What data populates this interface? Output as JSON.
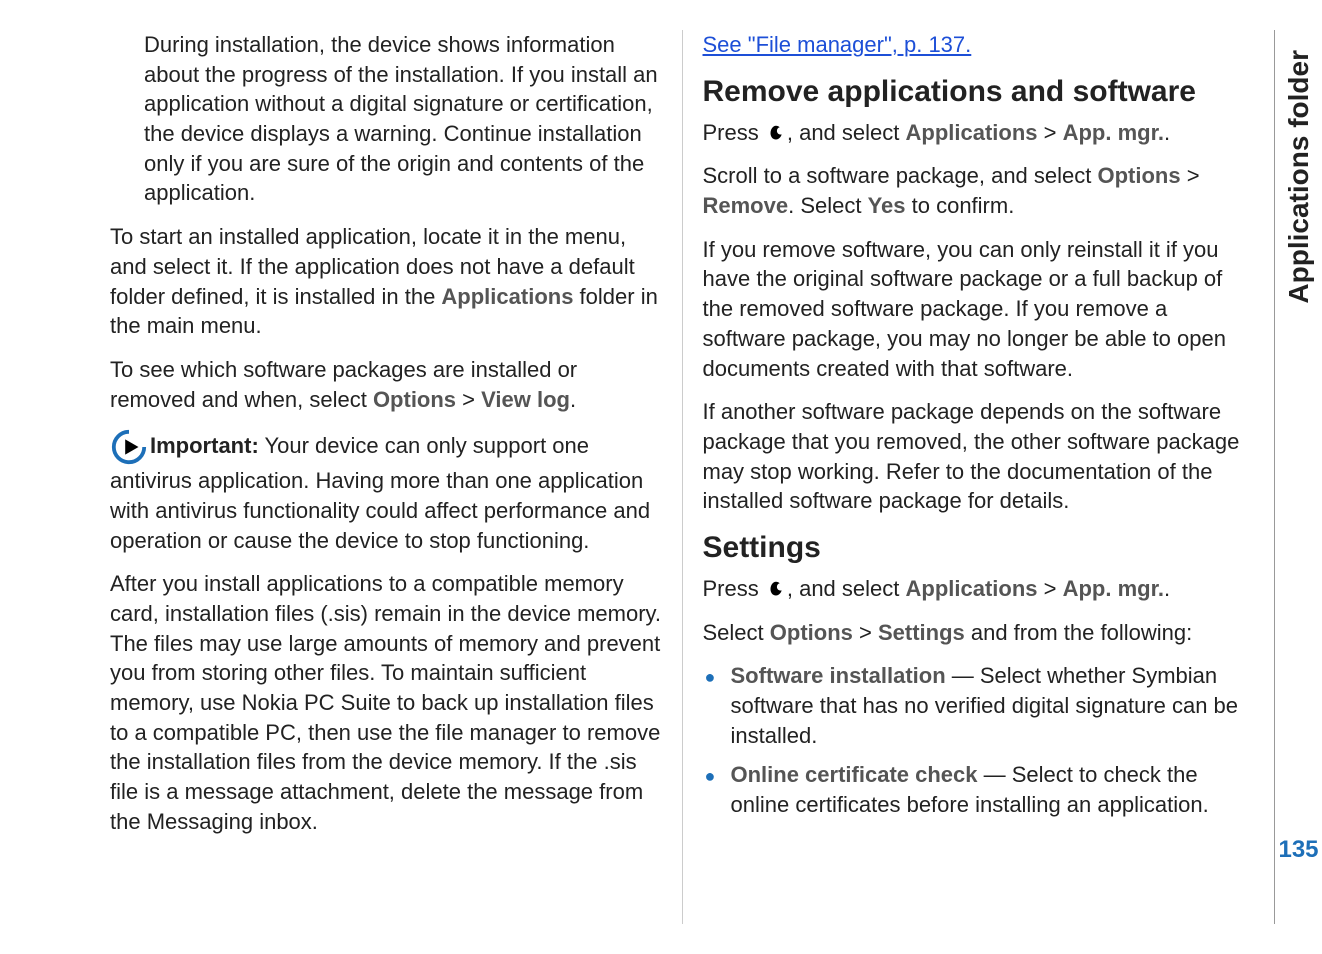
{
  "sidebar": {
    "title": "Applications folder",
    "page_number": "135"
  },
  "left": {
    "p1": "During installation, the device shows information about the progress of the installation. If you install an application without a digital signature or certification, the device displays a warning. Continue installation only if you are sure of the origin and contents of the application.",
    "p2a": "To start an installed application, locate it in the menu, and select it. If the application does not have a default folder defined, it is installed in the ",
    "p2_apps": "Applications",
    "p2b": " folder in the main menu.",
    "p3a": "To see which software packages are installed or removed and when, select ",
    "p3_options": "Options",
    "gt": " > ",
    "p3_viewlog": "View log",
    "period": ".",
    "important_label": "Important:",
    "important_text": "  Your device can only support one antivirus application. Having more than one application with antivirus functionality could affect performance and operation or cause the device to stop functioning.",
    "p5": "After you install applications to a compatible memory card, installation files (.sis) remain in the device memory. The files may use large amounts of memory and prevent you from storing other files. To maintain sufficient memory, use Nokia PC Suite to back up installation files to a compatible PC, then use the file manager to remove the installation files from the device memory. If the .sis file is a message attachment, delete the message from the Messaging inbox."
  },
  "right": {
    "link1": "See \"File manager\", p. 137.",
    "h_remove": "Remove applications and software",
    "press": "Press ",
    "and_select": ", and select ",
    "apps": "Applications",
    "gt": " > ",
    "appmgr": "App. mgr.",
    "period": ".",
    "r2a": "Scroll to a software package, and select ",
    "options": "Options",
    "remove": "Remove",
    "r2b": ". Select ",
    "yes": "Yes",
    "r2c": " to confirm.",
    "r3": "If you remove software, you can only reinstall it if you have the original software package or a full backup of the removed software package. If you remove a software package, you may no longer be able to open documents created with that software.",
    "r4": "If another software package depends on the software package that you removed, the other software package may stop working. Refer to the documentation of the installed software package for details.",
    "h_settings": "Settings",
    "s2a": "Select ",
    "settings_label": "Settings",
    "s2b": " and from the following:",
    "bullet1_label": "Software installation",
    "bullet1_text": " — Select whether Symbian software that has no verified digital signature can be installed.",
    "bullet2_label": "Online certificate check",
    "bullet2_text": "  — Select to check the online certificates before installing an application."
  }
}
